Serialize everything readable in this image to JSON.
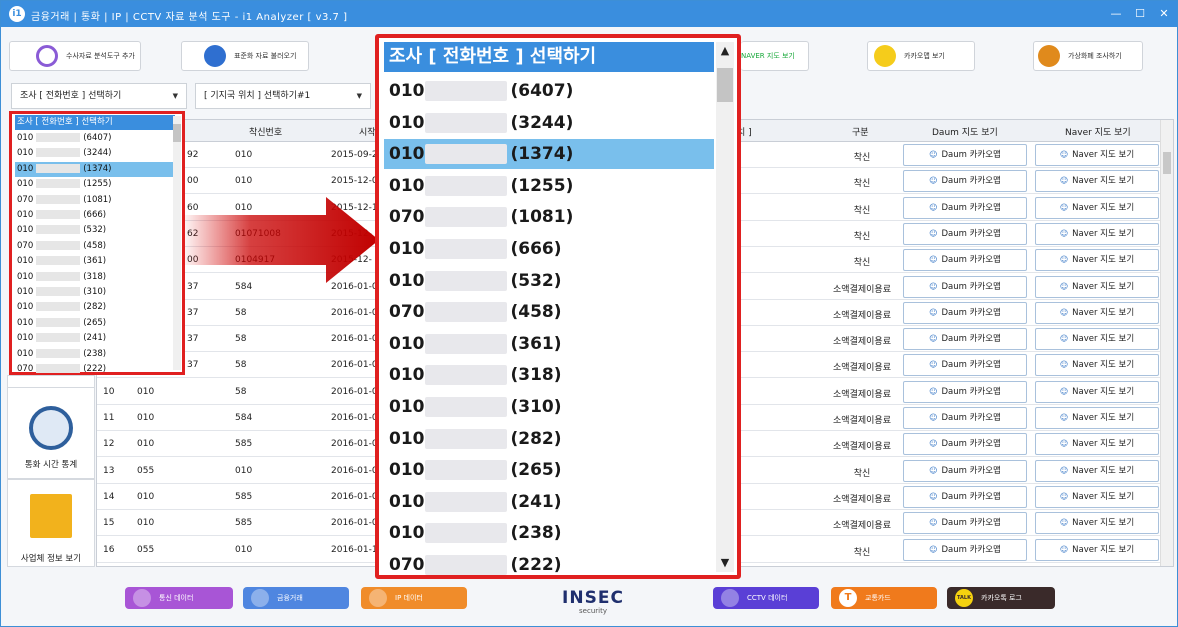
{
  "window": {
    "title": "금융거래 | 통화 | IP | CCTV 자료 분석 도구 - i1 Analyzer [ v3.7 ]",
    "logo_text": "i1",
    "controls": [
      "—",
      "☐",
      "✕"
    ]
  },
  "toolbar": {
    "add_tool_label": "수사자료 분석도구 추가",
    "load_std_label": "표준화 자료 불러오기",
    "naver_map_label": "NAVER 지도 보기",
    "kakao_map_label": "카카오맵 보기",
    "crypto_label": "가상화폐 조사하기"
  },
  "selects": {
    "phone_select": "조사 [ 전화번호 ] 선택하기",
    "base_station_select": "[ 기지국 위치 ] 선택하기#1"
  },
  "colors": {
    "accent": "#3a8ede",
    "highlight": "#79bfec",
    "alert_red": "#e02020"
  },
  "table": {
    "headers": {
      "callee": "착신번호",
      "start": "시작",
      "location_suffix": "치 ]",
      "type": "구분",
      "daum": "Daum 지도 보기",
      "naver": "Naver 지도 보기"
    },
    "daum_btn_label": "Daum 카카오맵",
    "naver_btn_label": "Naver 지도 보기",
    "rows": [
      {
        "no": "",
        "caller": "",
        "callee_prefix": "92",
        "callee": "010",
        "start": "2015-09-2",
        "type": "착신"
      },
      {
        "no": "",
        "caller": "",
        "callee_prefix": "00",
        "callee": "010",
        "start": "2015-12-0",
        "type": "착신"
      },
      {
        "no": "",
        "caller": "",
        "callee_prefix": "60",
        "callee": "010",
        "start": "2015-12-1",
        "type": "착신"
      },
      {
        "no": "",
        "caller": "",
        "callee_prefix": "62",
        "callee": "01071008",
        "start": "2015-12-",
        "type": "착신"
      },
      {
        "no": "",
        "caller": "",
        "callee_prefix": "00",
        "callee": "0104917",
        "start": "2015-12-",
        "type": "착신"
      },
      {
        "no": "",
        "caller": "",
        "callee_prefix": "37",
        "callee": "584",
        "start": "2016-01-0",
        "type": "소액결제이용료"
      },
      {
        "no": "",
        "caller": "",
        "callee_prefix": "37",
        "callee": "58",
        "start": "2016-01-0",
        "type": "소액결제이용료"
      },
      {
        "no": "",
        "caller": "",
        "callee_prefix": "37",
        "callee": "58",
        "start": "2016-01-0",
        "type": "소액결제이용료"
      },
      {
        "no": "",
        "caller": "",
        "callee_prefix": "37",
        "callee": "58",
        "start": "2016-01-0",
        "type": "소액결제이용료"
      },
      {
        "no": "10",
        "caller": "010",
        "callee_prefix": "",
        "callee": "58",
        "start": "2016-01-0",
        "type": "소액결제이용료"
      },
      {
        "no": "11",
        "caller": "010",
        "callee_prefix": "",
        "callee": "584",
        "start": "2016-01-0",
        "type": "소액결제이용료"
      },
      {
        "no": "12",
        "caller": "010",
        "callee_prefix": "",
        "callee": "585",
        "start": "2016-01-0",
        "type": "소액결제이용료"
      },
      {
        "no": "13",
        "caller": "055",
        "callee_prefix": "",
        "callee": "010",
        "start": "2016-01-0",
        "type": "착신"
      },
      {
        "no": "14",
        "caller": "010",
        "callee_prefix": "",
        "callee": "585",
        "start": "2016-01-0",
        "type": "소액결제이용료"
      },
      {
        "no": "15",
        "caller": "010",
        "callee_prefix": "",
        "callee": "585",
        "start": "2016-01-0",
        "type": "소액결제이용료"
      },
      {
        "no": "16",
        "caller": "055",
        "callee_prefix": "",
        "callee": "010",
        "start": "2016-01-1",
        "type": "착신"
      }
    ]
  },
  "left_panel": {
    "call_stats_label": "통화 시간 통계",
    "business_label": "사업체 정보 보기"
  },
  "phone_dropdown": {
    "header": "조사 [ 전화번호 ] 선택하기",
    "items": [
      {
        "prefix": "010",
        "count": "(6407)"
      },
      {
        "prefix": "010",
        "count": "(3244)"
      },
      {
        "prefix": "010",
        "count": "(1374)"
      },
      {
        "prefix": "010",
        "count": "(1255)"
      },
      {
        "prefix": "070",
        "count": "(1081)"
      },
      {
        "prefix": "010",
        "count": "(666)"
      },
      {
        "prefix": "010",
        "count": "(532)"
      },
      {
        "prefix": "070",
        "count": "(458)"
      },
      {
        "prefix": "010",
        "count": "(361)"
      },
      {
        "prefix": "010",
        "count": "(318)"
      },
      {
        "prefix": "010",
        "count": "(310)"
      },
      {
        "prefix": "010",
        "count": "(282)"
      },
      {
        "prefix": "010",
        "count": "(265)"
      },
      {
        "prefix": "010",
        "count": "(241)"
      },
      {
        "prefix": "010",
        "count": "(238)"
      },
      {
        "prefix": "070",
        "count": "(222)"
      }
    ],
    "selected_index": 2
  },
  "bottom_bar": {
    "telecom": "통신 데이터",
    "finance": "금융거래",
    "ip": "IP 데이터",
    "brand": "INSEC",
    "brand_sub": "security",
    "cctv": "CCTV 데이터",
    "transit": "교통카드",
    "kakaotalk": "카카오톡 로그",
    "talk_badge": "TALK",
    "transit_badge": "T"
  }
}
